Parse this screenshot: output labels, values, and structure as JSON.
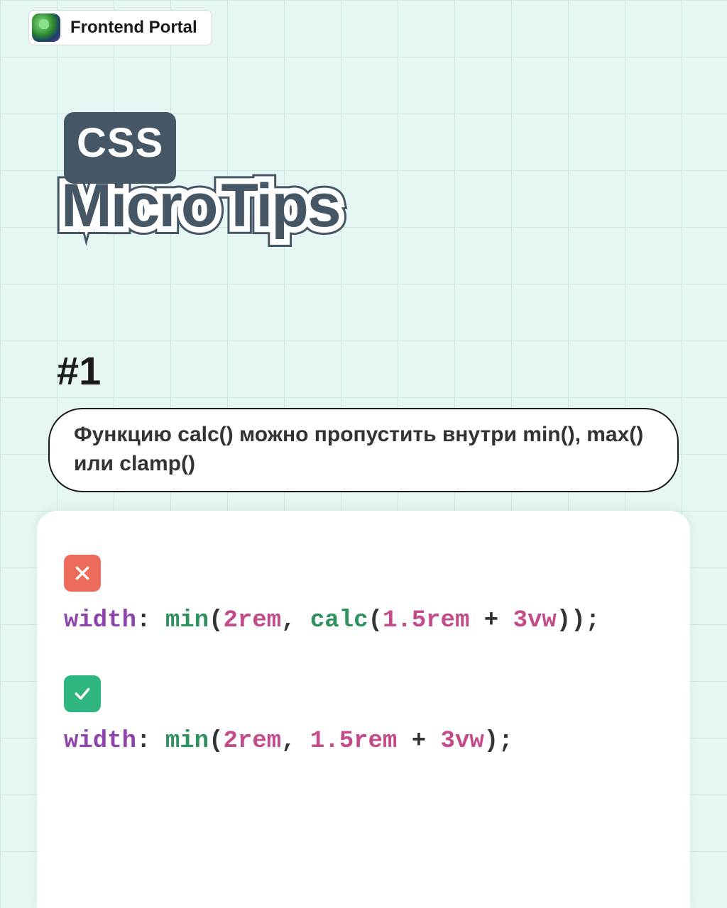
{
  "channel": {
    "name": "Frontend Portal"
  },
  "title": {
    "badge": "CSS",
    "word1": "Micro",
    "word2": "Tips"
  },
  "tip": {
    "number": "#1",
    "text": "Функцию calc() можно пропустить внутри min(), max() или clamp()"
  },
  "code": {
    "bad": {
      "tokens": {
        "t0": "width",
        "t1": ": ",
        "t2": "min",
        "t3": "(",
        "t4": "2rem",
        "t5": ", ",
        "t6": "calc",
        "t7": "(",
        "t8": "1.5rem",
        "t9": " + ",
        "t10": "3vw",
        "t11": "));"
      }
    },
    "good": {
      "tokens": {
        "t0": "width",
        "t1": ": ",
        "t2": "min",
        "t3": "(",
        "t4": "2rem",
        "t5": ", ",
        "t6": "1.5rem",
        "t7": " + ",
        "t8": "3vw",
        "t9": ");"
      }
    }
  }
}
